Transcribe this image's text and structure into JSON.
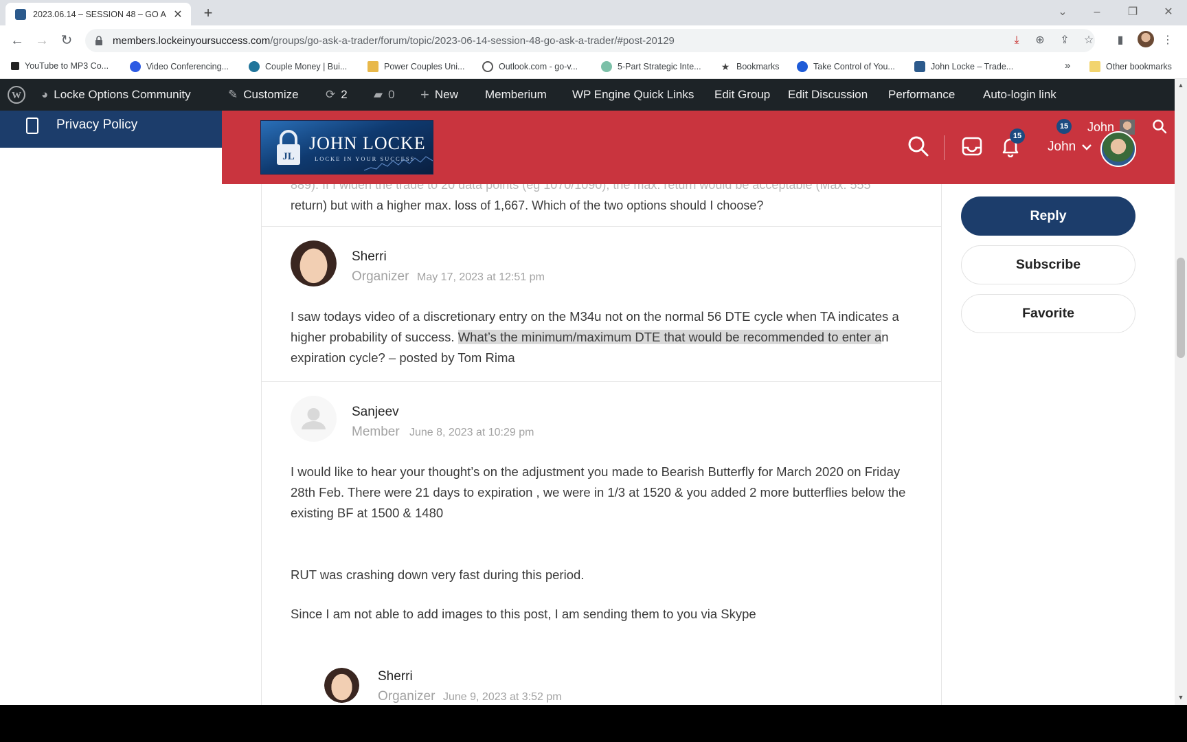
{
  "browser": {
    "tab_title": "2023.06.14 – SESSION 48 – GO A",
    "url_host": "members.lockeinyoursuccess.com",
    "url_path": "/groups/go-ask-a-trader/forum/topic/2023-06-14-session-48-go-ask-a-trader/#post-20129"
  },
  "bookmarks": [
    {
      "label": "YouTube to MP3 Co...",
      "icon": "music-note-icon",
      "color": "#222222"
    },
    {
      "label": "Video Conferencing...",
      "icon": "zoom-icon",
      "color": "#2d5be3"
    },
    {
      "label": "Couple Money | Bui...",
      "icon": "wordpress-icon",
      "color": "#21759b"
    },
    {
      "label": "Power Couples Uni...",
      "icon": "folder-image-icon",
      "color": "#e8b84a"
    },
    {
      "label": "Outlook.com - go-v...",
      "icon": "globe-icon",
      "color": "#555555"
    },
    {
      "label": "5-Part Strategic Inte...",
      "icon": "circle-site-icon",
      "color": "#7cc0a8"
    },
    {
      "label": "Bookmarks",
      "icon": "star-icon",
      "color": "#444444"
    },
    {
      "label": "Take Control of You...",
      "icon": "swirl-site-icon",
      "color": "#1e5bd7"
    },
    {
      "label": "John Locke – Trade...",
      "icon": "lock-site-icon",
      "color": "#2c5a8c"
    }
  ],
  "bookmarks_more": "»",
  "other_bookmarks": "Other bookmarks",
  "adminbar": {
    "site_name": "Locke Options Community",
    "customize": "Customize",
    "updates_count": "2",
    "comments_count": "0",
    "new": "New",
    "memberium": "Memberium",
    "wp_engine": "WP Engine Quick Links",
    "edit_group": "Edit Group",
    "edit_discussion": "Edit Discussion",
    "performance": "Performance",
    "auto_login": "Auto-login link"
  },
  "left_panel": {
    "privacy": "Privacy Policy"
  },
  "header": {
    "brand": "JOHN LOCKE",
    "tagline": "LOCKE IN YOUR SUCCESS",
    "notifications_count": "15",
    "user_top_count": "15",
    "user_top_name": "John",
    "user_name": "John"
  },
  "posts": {
    "partial_line1": "889). If I widen the trade to 20 data points (eg 1070/1090), the max. return would be acceptable (Max. 555",
    "partial_line2": "return) but with a higher max. loss of 1,667. Which of the two options should I choose?",
    "p1": {
      "name": "Sherri",
      "role": "Organizer",
      "date": "May 17, 2023 at 12:51 pm",
      "body_a": "I saw todays video of a discretionary entry on the M34u not on the normal 56 DTE cycle when TA indicates a higher probability of success. ",
      "body_highlight": "What’s the minimum/maximum DTE that would be recommended to enter a",
      "body_b": "n expiration cycle? – posted by Tom Rima"
    },
    "p2": {
      "name": "Sanjeev",
      "role": "Member",
      "date": "June 8, 2023 at 10:29 pm",
      "para1": "I would like to hear your thought’s on the adjustment you made to Bearish Butterfly for March 2020 on Friday 28th Feb. There were 21 days to expiration , we were in 1/3 at 1520 & you added 2 more butterflies below the existing BF at 1500 & 1480",
      "para2": "RUT was crashing down very fast during this period.",
      "para3": "Since I am not able to add images to this post, I am sending them to you via Skype"
    },
    "p3": {
      "name": "Sherri",
      "role": "Organizer",
      "date": "June 9, 2023 at 3:52 pm"
    }
  },
  "sidebar": {
    "reply": "Reply",
    "subscribe": "Subscribe",
    "favorite": "Favorite"
  },
  "colors": {
    "header_red": "#c9343e",
    "navy": "#1c3d6b",
    "adminbar": "#1d2327"
  }
}
